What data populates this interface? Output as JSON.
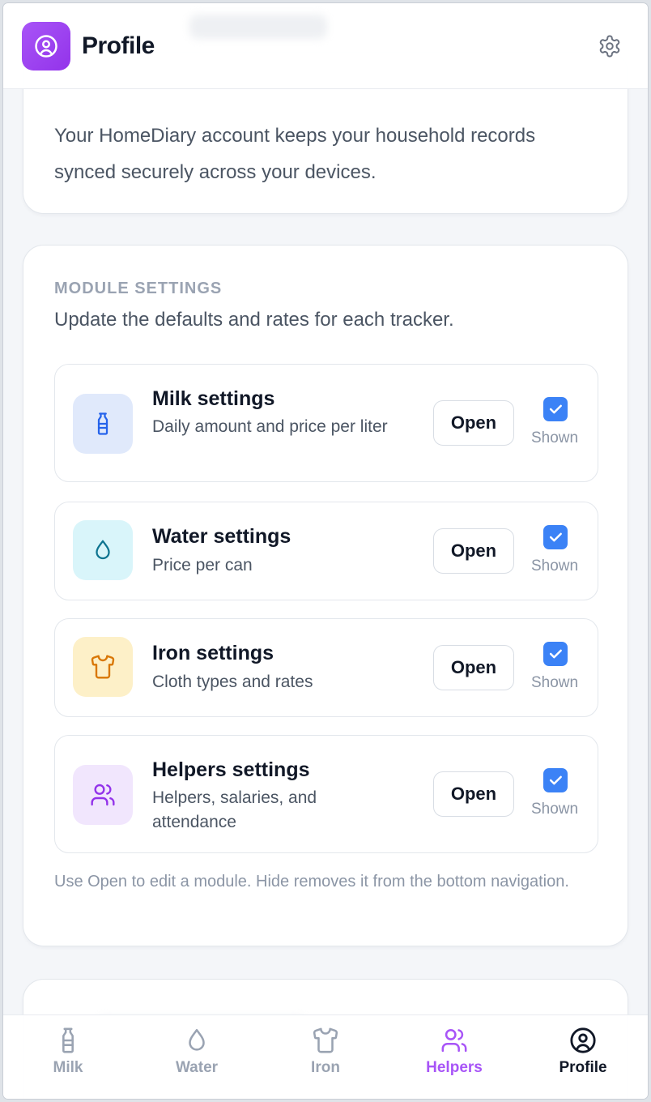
{
  "header": {
    "title": "Profile"
  },
  "account": {
    "intro": "Your HomeDiary account keeps your household records synced securely across your devices."
  },
  "modules_section": {
    "label": "MODULE SETTINGS",
    "description": "Update the defaults and rates for each tracker.",
    "items": [
      {
        "title": "Milk settings",
        "subtitle": "Daily amount and price per liter",
        "open_label": "Open",
        "shown_label": "Shown",
        "shown": true,
        "icon": "milk-bottle-icon",
        "icon_bg": "#e0e9fb",
        "icon_color": "#2563eb"
      },
      {
        "title": "Water settings",
        "subtitle": "Price per can",
        "open_label": "Open",
        "shown_label": "Shown",
        "shown": true,
        "icon": "water-drop-icon",
        "icon_bg": "#d9f5fa",
        "icon_color": "#0e7490"
      },
      {
        "title": "Iron settings",
        "subtitle": "Cloth types and rates",
        "open_label": "Open",
        "shown_label": "Shown",
        "shown": true,
        "icon": "shirt-icon",
        "icon_bg": "#fdf0c8",
        "icon_color": "#d97706"
      },
      {
        "title": "Helpers settings",
        "subtitle": "Helpers, salaries, and attendance",
        "open_label": "Open",
        "shown_label": "Shown",
        "shown": true,
        "icon": "users-icon",
        "icon_bg": "#f1e6fd",
        "icon_color": "#9333ea"
      }
    ],
    "footnote": "Use Open to edit a module. Hide removes it from the bottom navigation."
  },
  "nav": {
    "items": [
      {
        "label": "Milk",
        "icon": "milk-bottle-icon",
        "active": false
      },
      {
        "label": "Water",
        "icon": "water-drop-icon",
        "active": false
      },
      {
        "label": "Iron",
        "icon": "shirt-icon",
        "active": false
      },
      {
        "label": "Helpers",
        "icon": "users-icon",
        "active": false
      },
      {
        "label": "Profile",
        "icon": "user-circle-icon",
        "active": true
      }
    ]
  },
  "colors": {
    "accent": "#a855f7",
    "checkbox": "#3b82f6",
    "text_primary": "#111827",
    "text_secondary": "#4b5563",
    "text_muted": "#9aa3b2"
  }
}
